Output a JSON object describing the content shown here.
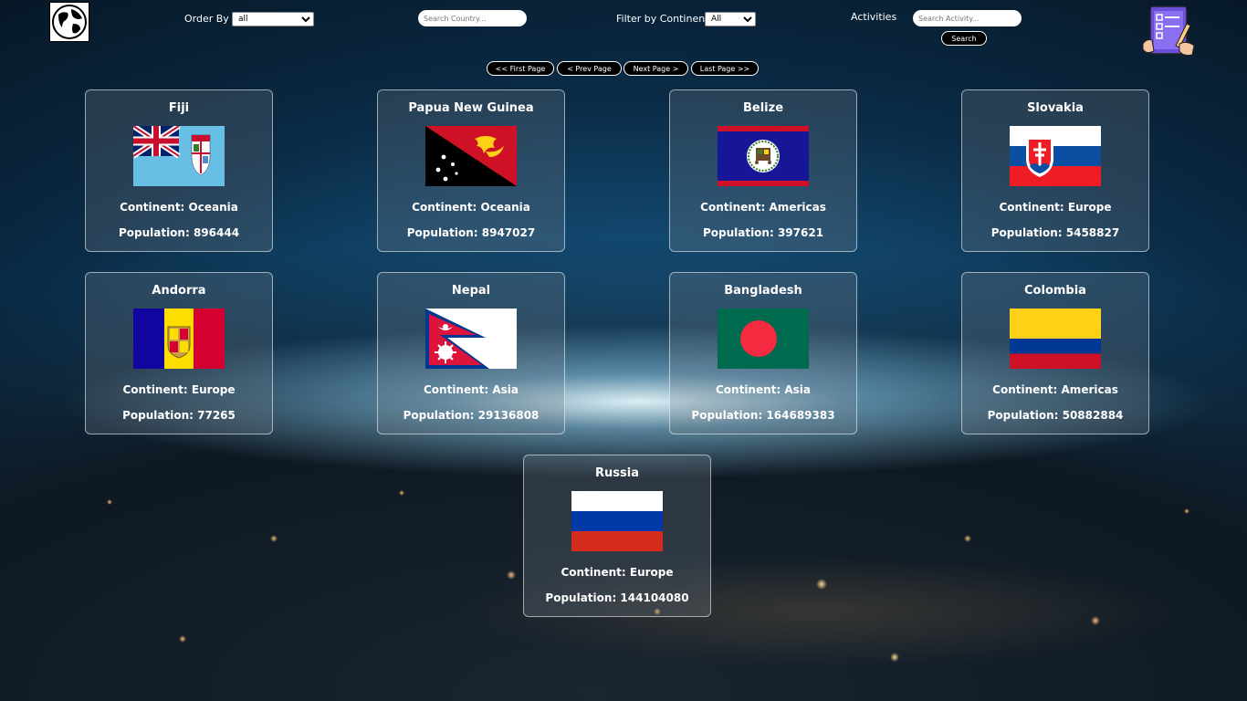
{
  "header": {
    "order_by_label": "Order By",
    "order_by_value": "all",
    "search_country_placeholder": "Search Country...",
    "filter_continent_label": "Filter by Continent",
    "filter_continent_value": "All",
    "activities_label": "Activities",
    "search_activity_placeholder": "Search Activity...",
    "search_button": "Search"
  },
  "pagination": {
    "first": "<< First Page",
    "prev": "< Prev Page",
    "next": "Next Page >",
    "last": "Last Page >>"
  },
  "countries": [
    {
      "name": "Fiji",
      "continent": "Continent: Oceania",
      "population": "Population: 896444",
      "flag": "fiji-flag"
    },
    {
      "name": "Papua New Guinea",
      "continent": "Continent: Oceania",
      "population": "Population: 8947027",
      "flag": "papua-new-guinea-flag"
    },
    {
      "name": "Belize",
      "continent": "Continent: Americas",
      "population": "Population: 397621",
      "flag": "belize-flag"
    },
    {
      "name": "Slovakia",
      "continent": "Continent: Europe",
      "population": "Population: 5458827",
      "flag": "slovakia-flag"
    },
    {
      "name": "Andorra",
      "continent": "Continent: Europe",
      "population": "Population: 77265",
      "flag": "andorra-flag"
    },
    {
      "name": "Nepal",
      "continent": "Continent: Asia",
      "population": "Population: 29136808",
      "flag": "nepal-flag"
    },
    {
      "name": "Bangladesh",
      "continent": "Continent: Asia",
      "population": "Population: 164689383",
      "flag": "bangladesh-flag"
    },
    {
      "name": "Colombia",
      "continent": "Continent: Americas",
      "population": "Population: 50882884",
      "flag": "colombia-flag"
    },
    {
      "name": "Russia",
      "continent": "Continent: Europe",
      "population": "Population: 144104080",
      "flag": "russia-flag"
    }
  ],
  "icons": {
    "logo": "globe-icon",
    "activities": "checklist-icon"
  }
}
